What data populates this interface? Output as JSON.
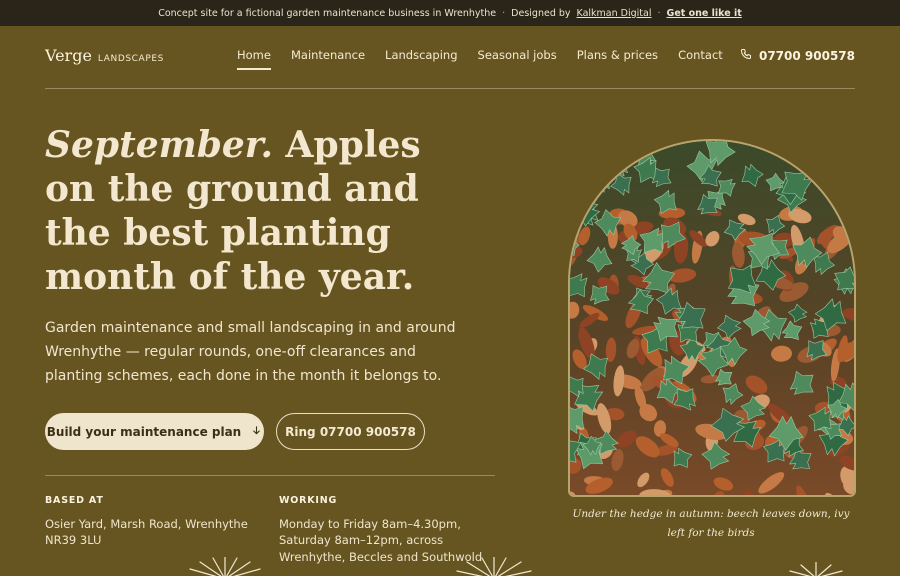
{
  "topbar": {
    "notice": "Concept site for a fictional garden maintenance business in Wrenhythe",
    "sep1": "·",
    "designed_prefix": "Designed by",
    "designer": "Kalkman Digital",
    "sep2": "·",
    "cta": "Get one like it"
  },
  "brand": {
    "name": "Verge",
    "suffix": "LANDSCAPES"
  },
  "nav": {
    "items": [
      {
        "label": "Home",
        "active": true
      },
      {
        "label": "Maintenance"
      },
      {
        "label": "Landscaping"
      },
      {
        "label": "Seasonal jobs"
      },
      {
        "label": "Plans & prices"
      },
      {
        "label": "Contact"
      }
    ]
  },
  "header": {
    "phone": "07700 900578",
    "phone_icon": "phone-icon"
  },
  "hero": {
    "headline_italic": "September.",
    "headline_rest": " Apples on the ground and the best planting month of the year.",
    "lede": "Garden maintenance and small landscaping in and around Wrenhythe — regular rounds, one-off clearances and planting schemes, each done in the month it belongs to.",
    "primary_button": "Build your maintenance plan",
    "primary_icon": "arrow-down-icon",
    "secondary_button": "Ring 07700 900578"
  },
  "details": {
    "based_label": "BASED AT",
    "based_value": "Osier Yard, Marsh Road, Wrenhythe NR39 3LU",
    "working_label": "WORKING",
    "working_value": "Monday to Friday 8am–4.30pm, Saturday 8am–12pm, across Wrenhythe, Beccles and Southwold"
  },
  "photo": {
    "caption": "Under the hedge in autumn: beech leaves down, ivy left for the birds"
  },
  "colors": {
    "background": "#675521",
    "topbar": "#2a2518",
    "cream": "#efe5cc",
    "ivy": "#3f7a4e",
    "beech": "#b5602c"
  }
}
